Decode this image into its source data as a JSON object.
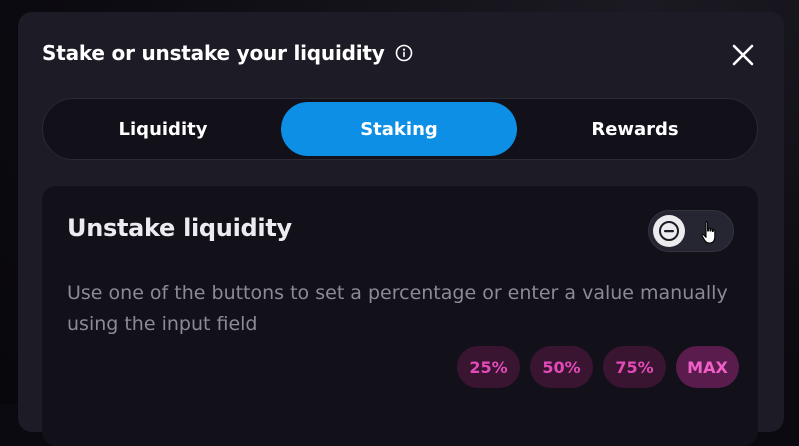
{
  "modal": {
    "title": "Stake or unstake your liquidity",
    "info_icon": "info-circle-icon",
    "close_icon": "close-x-icon"
  },
  "tabs": [
    {
      "label": "Liquidity",
      "active": false
    },
    {
      "label": "Staking",
      "active": true
    },
    {
      "label": "Rewards",
      "active": false
    }
  ],
  "panel": {
    "title": "Unstake liquidity",
    "toggle_state": "unstake",
    "toggle_icon": "minus-icon",
    "description": "Use one of the buttons to set a percentage or enter a value manually using the input field",
    "percent_buttons": [
      "25%",
      "50%",
      "75%",
      "MAX"
    ]
  },
  "colors": {
    "accent": "#0d8fe6",
    "pink_text": "#e24ab8",
    "pink_bg": "#3a1532"
  }
}
